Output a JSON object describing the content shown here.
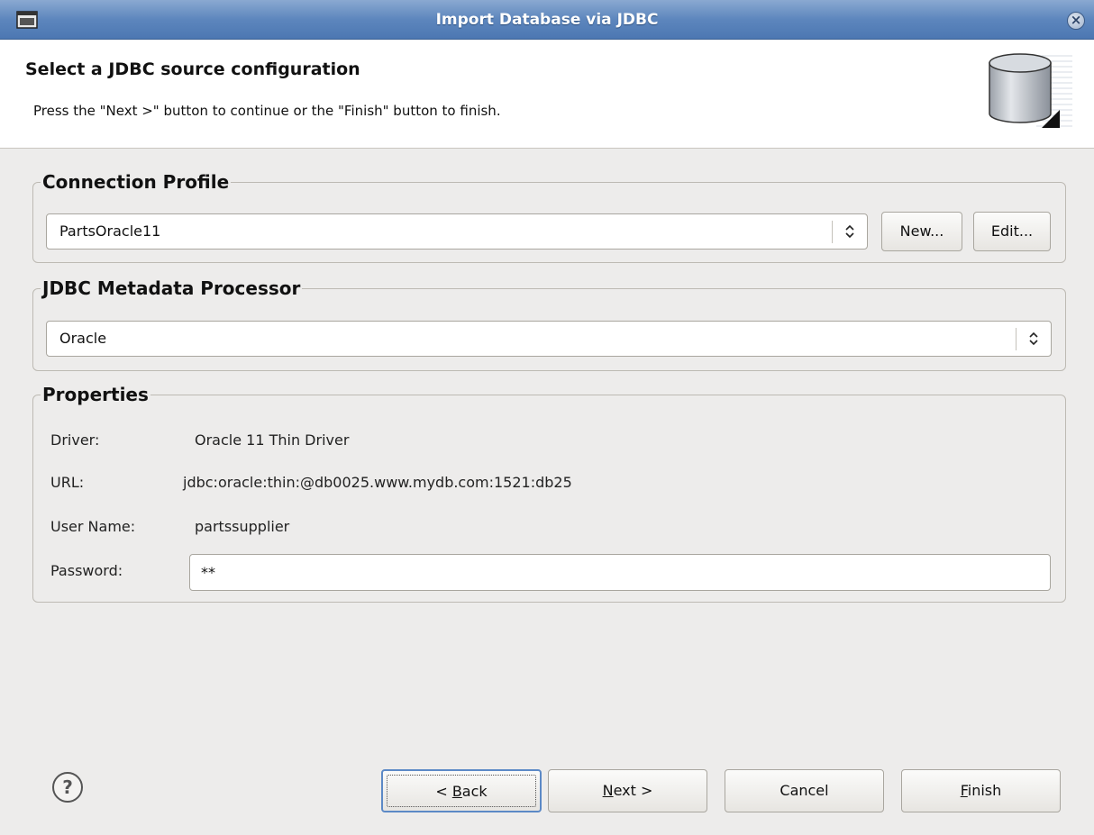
{
  "window": {
    "title": "Import Database via JDBC",
    "icon": "window-icon",
    "close_icon": "close-icon"
  },
  "header": {
    "title": "Select a JDBC source configuration",
    "description": "Press the \"Next >\" button to continue or the \"Finish\" button to finish.",
    "icon": "database-icon"
  },
  "connection_profile": {
    "legend": "Connection Profile",
    "selected": "PartsOracle11",
    "new_label": "New...",
    "edit_label": "Edit..."
  },
  "metadata_processor": {
    "legend": "JDBC Metadata Processor",
    "selected": "Oracle"
  },
  "properties": {
    "legend": "Properties",
    "driver_label": "Driver:",
    "driver_value": "Oracle 11 Thin Driver",
    "url_label": "URL:",
    "url_value": "jdbc:oracle:thin:@db0025.www.mydb.com:1521:db25",
    "username_label": "User Name:",
    "username_value": "partssupplier",
    "password_label": "Password:",
    "password_value": "**"
  },
  "footer": {
    "help_icon": "help-icon",
    "back_prefix": "< ",
    "back_mnemonic": "B",
    "back_rest": "ack",
    "next_mnemonic": "N",
    "next_rest": "ext >",
    "cancel_label": "Cancel",
    "finish_mnemonic": "F",
    "finish_rest": "inish"
  },
  "colors": {
    "titlebar": "#5d86bd",
    "dialog_bg": "#edeceb",
    "focus": "#5c89c6"
  }
}
